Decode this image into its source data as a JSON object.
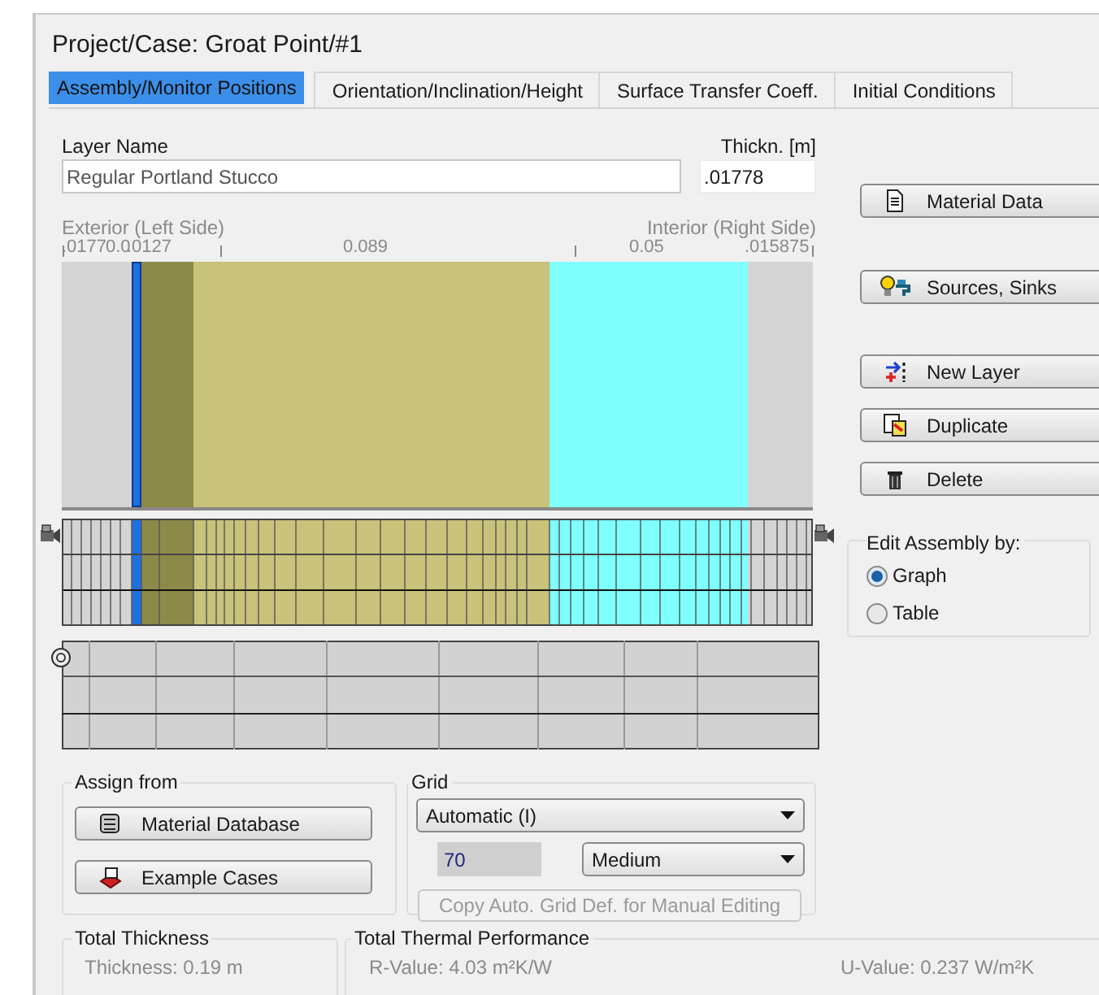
{
  "title": "Project/Case:  Groat Point/#1",
  "tabs": [
    {
      "label": "Assembly/Monitor Positions",
      "selected": true
    },
    {
      "label": "Orientation/Inclination/Height",
      "selected": false
    },
    {
      "label": "Surface Transfer Coeff.",
      "selected": false
    },
    {
      "label": "Initial Conditions",
      "selected": false
    }
  ],
  "layer_name": {
    "label": "Layer Name",
    "value": "Regular Portland Stucco"
  },
  "thickness": {
    "label": "Thickn. [m]",
    "value": ".01778"
  },
  "sides": {
    "exterior": "Exterior (Left Side)",
    "interior": "Interior (Right Side)"
  },
  "ruler": [
    ".0177",
    "0.0",
    ".0127",
    "0.089",
    "0.05",
    ".015875"
  ],
  "layers": [
    {
      "color": "#d4d4d4",
      "selected": false
    },
    {
      "color": "#1f6fe0",
      "selected": true
    },
    {
      "color": "#8c8a48",
      "selected": false
    },
    {
      "color": "#c8c27a",
      "selected": false
    },
    {
      "color": "#80ffff",
      "selected": false
    },
    {
      "color": "#d4d4d4",
      "selected": false
    }
  ],
  "side_buttons": [
    {
      "kind": "doc",
      "label": "Material Data"
    },
    {
      "kind": "sources",
      "label": "Sources, Sinks"
    },
    {
      "kind": "new",
      "label": "New Layer"
    },
    {
      "kind": "dup",
      "label": "Duplicate"
    },
    {
      "kind": "trash",
      "label": "Delete"
    }
  ],
  "edit_by": {
    "label": "Edit Assembly by:",
    "options": [
      {
        "label": "Graph",
        "selected": true
      },
      {
        "label": "Table",
        "selected": false
      }
    ]
  },
  "assign": {
    "label": "Assign from",
    "buttons": [
      {
        "kind": "db",
        "label": "Material Database"
      },
      {
        "kind": "examples",
        "label": "Example Cases"
      }
    ]
  },
  "grid": {
    "label": "Grid",
    "mode": "Automatic (I)",
    "count": "70",
    "density": "Medium",
    "copy_button": {
      "label": "Copy Auto. Grid Def. for Manual Editing",
      "disabled": true
    }
  },
  "total_thickness": {
    "label": "Total Thickness",
    "value": "Thickness: 0.19 m"
  },
  "thermal": {
    "label": "Total Thermal Performance",
    "r_value": "R-Value: 4.03 m²K/W",
    "u_value": "U-Value: 0.237 W/m²K"
  }
}
